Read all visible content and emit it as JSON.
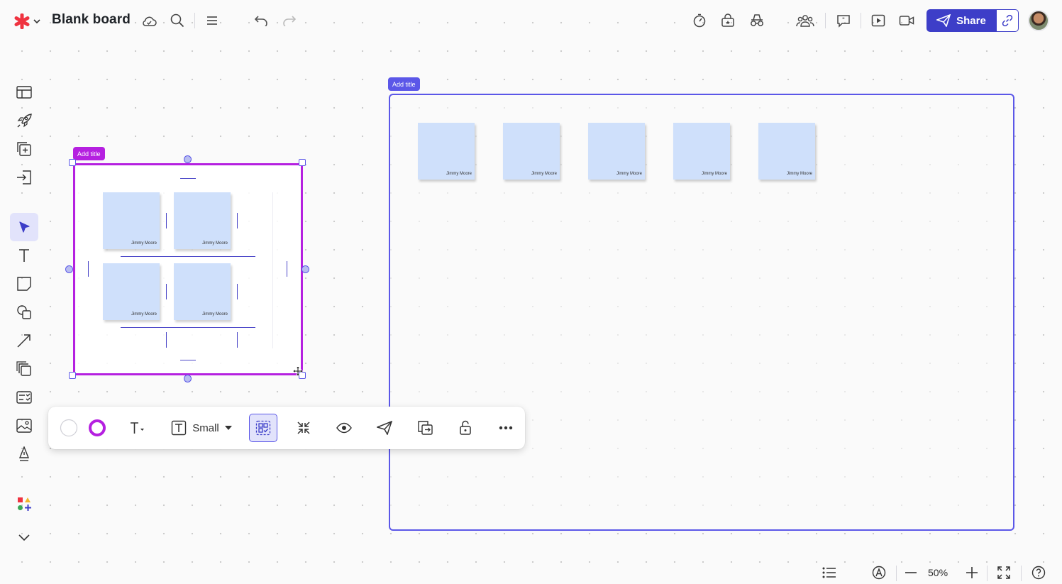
{
  "app": {
    "board_title": "Blank board",
    "accent": "#3d3ec8",
    "brand": "#ef3340"
  },
  "topbar": {
    "left_icons": [
      "logo-icon",
      "chevron-down-icon",
      "cloud-sync-icon",
      "search-icon",
      "menu-icon",
      "undo-icon",
      "redo-icon"
    ],
    "right_icons": [
      "timer-icon",
      "lock-box-icon",
      "incognito-icon",
      "collaborators-icon",
      "comment-icon",
      "present-icon",
      "video-icon",
      "link-icon"
    ],
    "share_label": "Share"
  },
  "left_toolbar": {
    "items": [
      "template-icon",
      "rocket-icon",
      "add-frame-icon",
      "import-icon",
      "select-icon",
      "text-icon",
      "sticky-note-icon",
      "shapes-icon",
      "connector-icon",
      "layers-icon",
      "data-icon",
      "image-icon",
      "ink-icon",
      "integrations-icon",
      "chevron-down-icon"
    ],
    "active": "select-icon"
  },
  "canvas": {
    "frame_left": {
      "title_tag": "Add title",
      "tag_color": "#b520e0",
      "stickies": [
        {
          "author": "Jimmy Moore"
        },
        {
          "author": "Jimmy Moore"
        },
        {
          "author": "Jimmy Moore"
        },
        {
          "author": "Jimmy Moore"
        }
      ]
    },
    "frame_right": {
      "title_tag": "Add title",
      "tag_color": "#5b57e8",
      "stickies": [
        {
          "author": "Jimmy Moore"
        },
        {
          "author": "Jimmy Moore"
        },
        {
          "author": "Jimmy Moore"
        },
        {
          "author": "Jimmy Moore"
        },
        {
          "author": "Jimmy Moore"
        }
      ]
    },
    "sticky_color": "#cfe0fb"
  },
  "context_toolbar": {
    "font_size_label": "Small",
    "items": [
      "fill-color-icon",
      "border-color-icon",
      "text-style-icon",
      "text-frame-icon",
      "select-contents-icon",
      "collapse-icon",
      "visibility-icon",
      "send-icon",
      "export-icon",
      "unlock-icon",
      "more-icon"
    ]
  },
  "bottom_bar": {
    "zoom": "50%",
    "icons": [
      "list-icon",
      "accessibility-icon",
      "zoom-out-icon",
      "zoom-in-icon",
      "fit-screen-icon",
      "help-icon"
    ]
  }
}
